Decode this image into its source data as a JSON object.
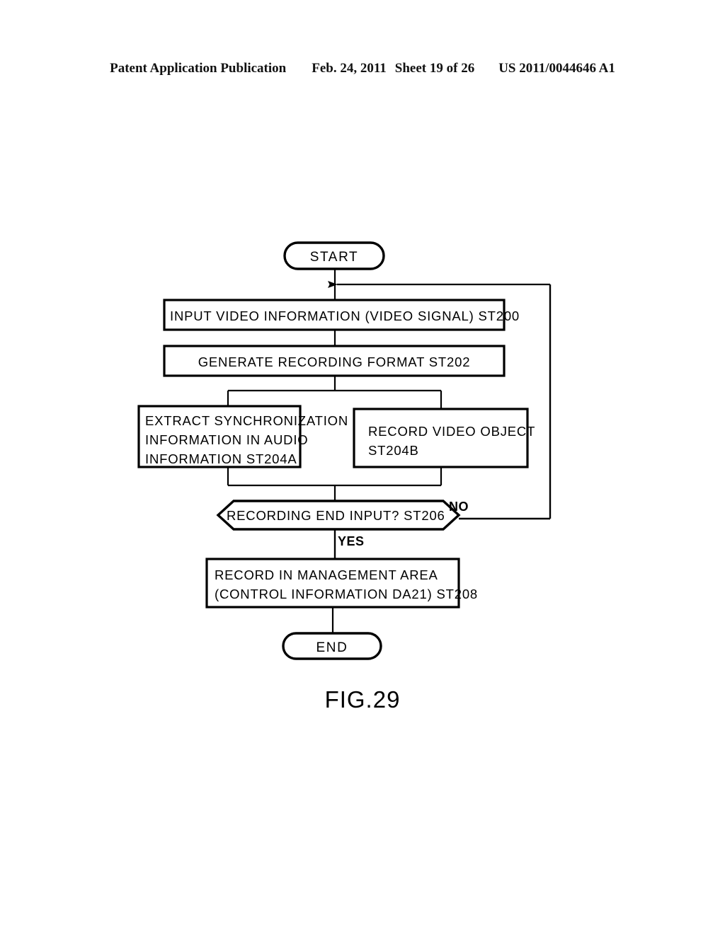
{
  "header": {
    "publication": "Patent Application Publication",
    "date": "Feb. 24, 2011",
    "sheet": "Sheet 19 of 26",
    "patent_number": "US 2011/0044646 A1"
  },
  "figure": {
    "caption": "FIG.29",
    "line_color": "#000000",
    "background_color": "#ffffff"
  },
  "flowchart": {
    "start": {
      "label": "START"
    },
    "step_st200": {
      "label": "INPUT VIDEO INFORMATION (VIDEO SIGNAL) ST200"
    },
    "step_st202": {
      "label": "GENERATE RECORDING FORMAT ST202"
    },
    "step_st204a": {
      "line1": "EXTRACT SYNCHRONIZATION",
      "line2": "INFORMATION IN AUDIO",
      "line3": "INFORMATION ST204A"
    },
    "step_st204b": {
      "line1": "RECORD VIDEO OBJECT",
      "line2": "ST204B"
    },
    "decision_st206": {
      "label": "RECORDING END INPUT? ST206"
    },
    "branch_no": {
      "label": "NO"
    },
    "branch_yes": {
      "label": "YES"
    },
    "step_st208": {
      "line1": "RECORD IN MANAGEMENT AREA",
      "line2": "(CONTROL INFORMATION DA21) ST208"
    },
    "end": {
      "label": "END"
    }
  }
}
